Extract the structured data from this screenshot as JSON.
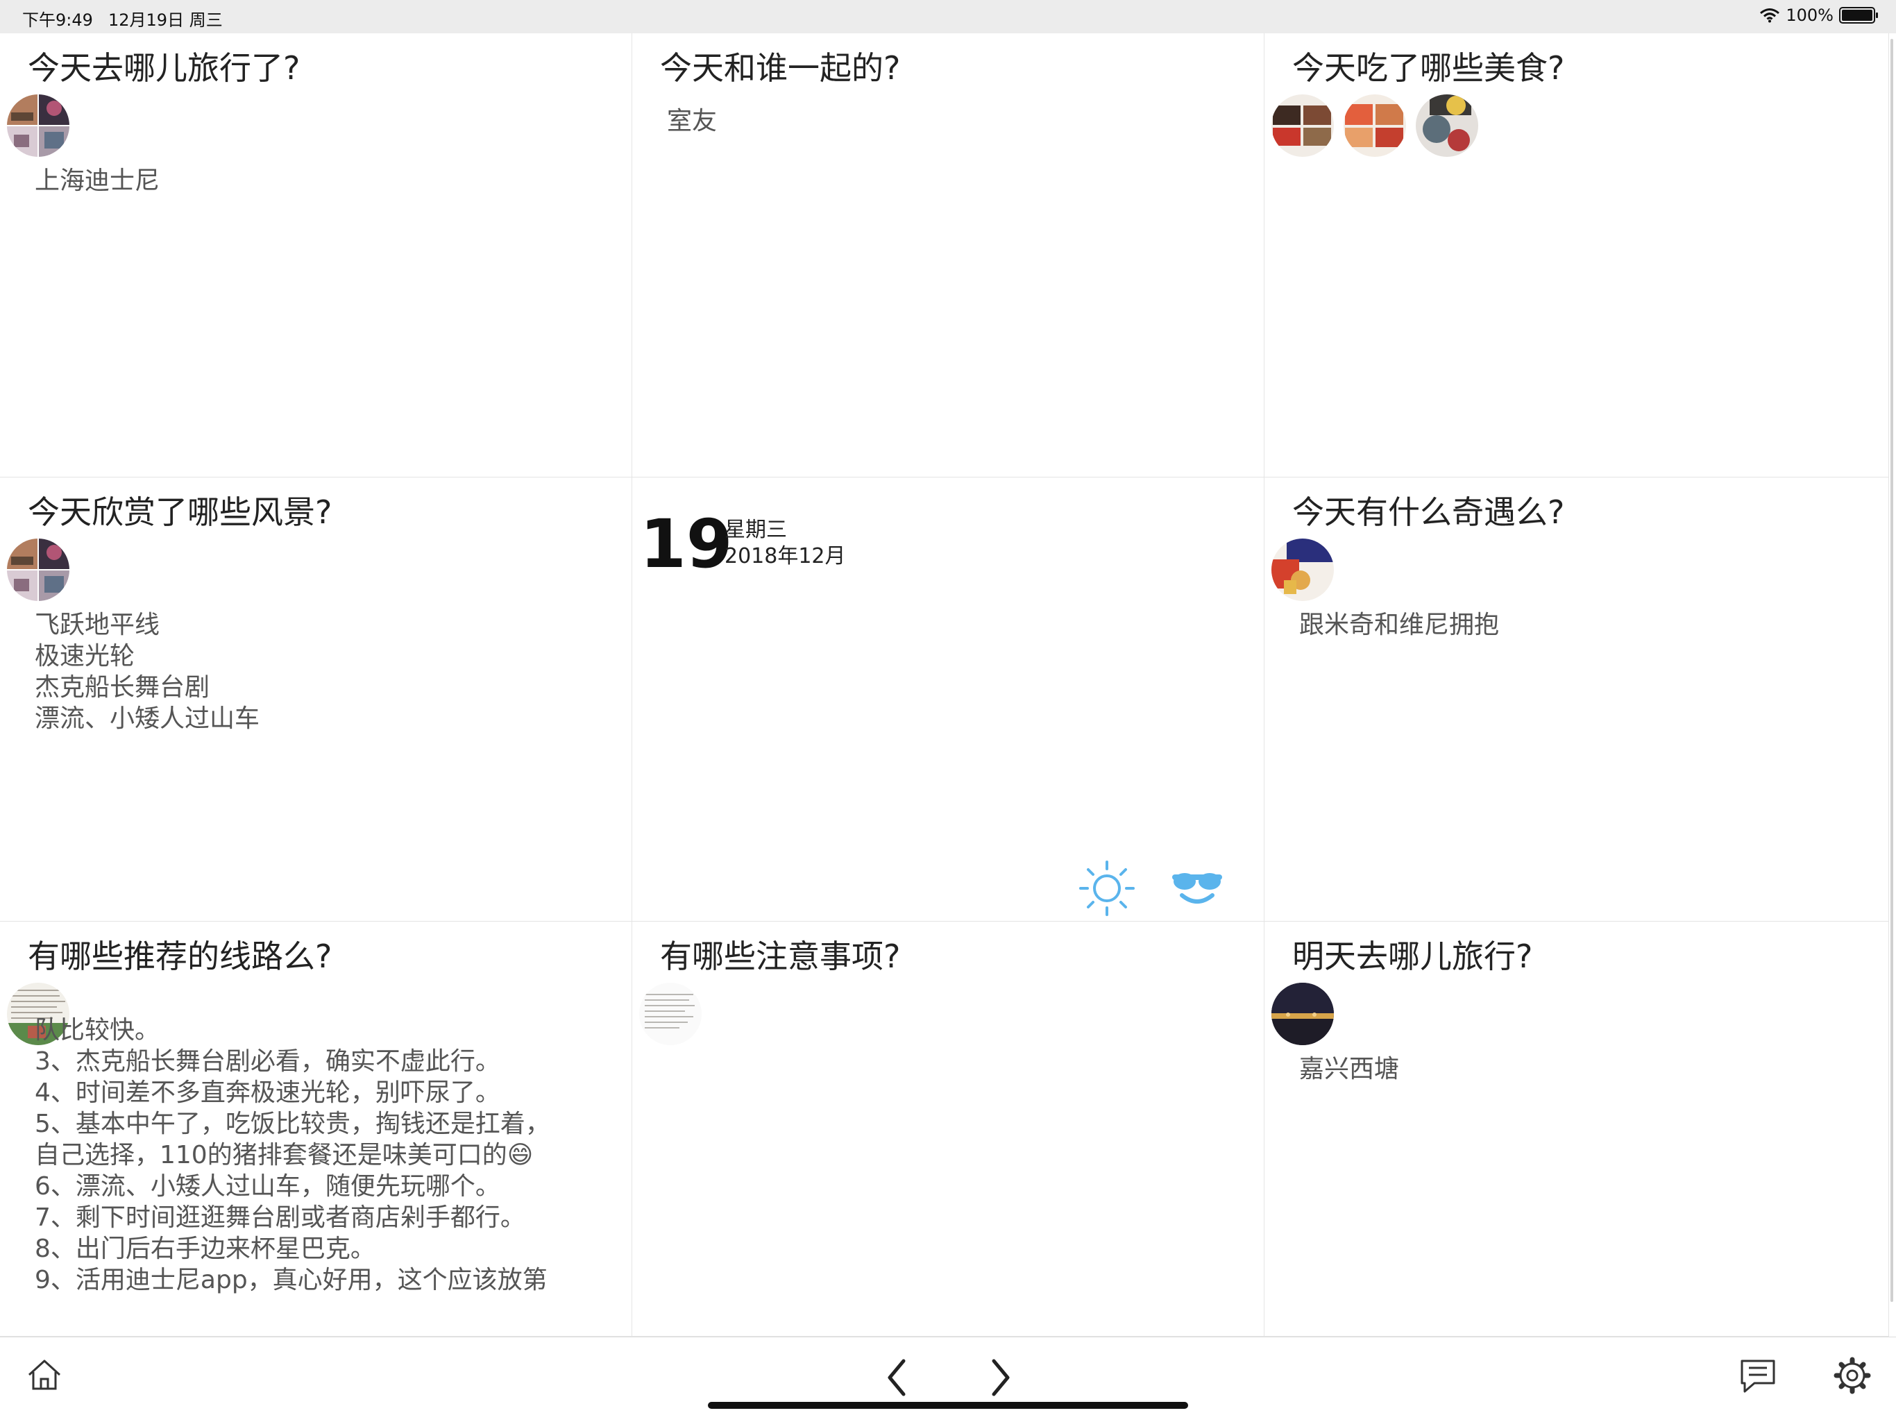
{
  "status_bar": {
    "time": "下午9:49",
    "date": "12月19日 周三",
    "battery": "100%"
  },
  "colors": {
    "accent": "#5ab4ec",
    "text": "#222222",
    "secondary": "#555555",
    "divider": "#e4e4e4"
  },
  "cards": {
    "travel_today": {
      "question": "今天去哪儿旅行了?",
      "answer": "上海迪士尼"
    },
    "companion": {
      "question": "今天和谁一起的?",
      "answer": "室友"
    },
    "food": {
      "question": "今天吃了哪些美食?"
    },
    "scenery": {
      "question": "今天欣赏了哪些风景?",
      "answer": "飞跃地平线\n极速光轮\n杰克船长舞台剧\n漂流、小矮人过山车"
    },
    "today": {
      "day": "19",
      "weekday": "星期三",
      "year_month": "2018年12月",
      "weather_icon": "sun-icon",
      "mood_icon": "sunglasses-smile-icon"
    },
    "encounter": {
      "question": "今天有什么奇遇么?",
      "answer": "跟米奇和维尼拥抱"
    },
    "routes": {
      "question": "有哪些推荐的线路么?",
      "answer": "队比较快。\n3、杰克船长舞台剧必看，确实不虚此行。\n4、时间差不多直奔极速光轮，别吓尿了。\n5、基本中午了，吃饭比较贵，掏钱还是扛着，\n自己选择，110的猪排套餐还是味美可口的😄\n6、漂流、小矮人过山车，随便先玩哪个。\n7、剩下时间逛逛舞台剧或者商店剁手都行。\n8、出门后右手边来杯星巴克。\n9、活用迪士尼app，真心好用，这个应该放第"
    },
    "notes": {
      "question": "有哪些注意事项?"
    },
    "travel_tomorrow": {
      "question": "明天去哪儿旅行?",
      "answer": "嘉兴西塘"
    }
  },
  "toolbar": {
    "home": "home-icon",
    "prev": "chevron-left-icon",
    "next": "chevron-right-icon",
    "notes": "message-icon",
    "settings": "gear-icon"
  }
}
